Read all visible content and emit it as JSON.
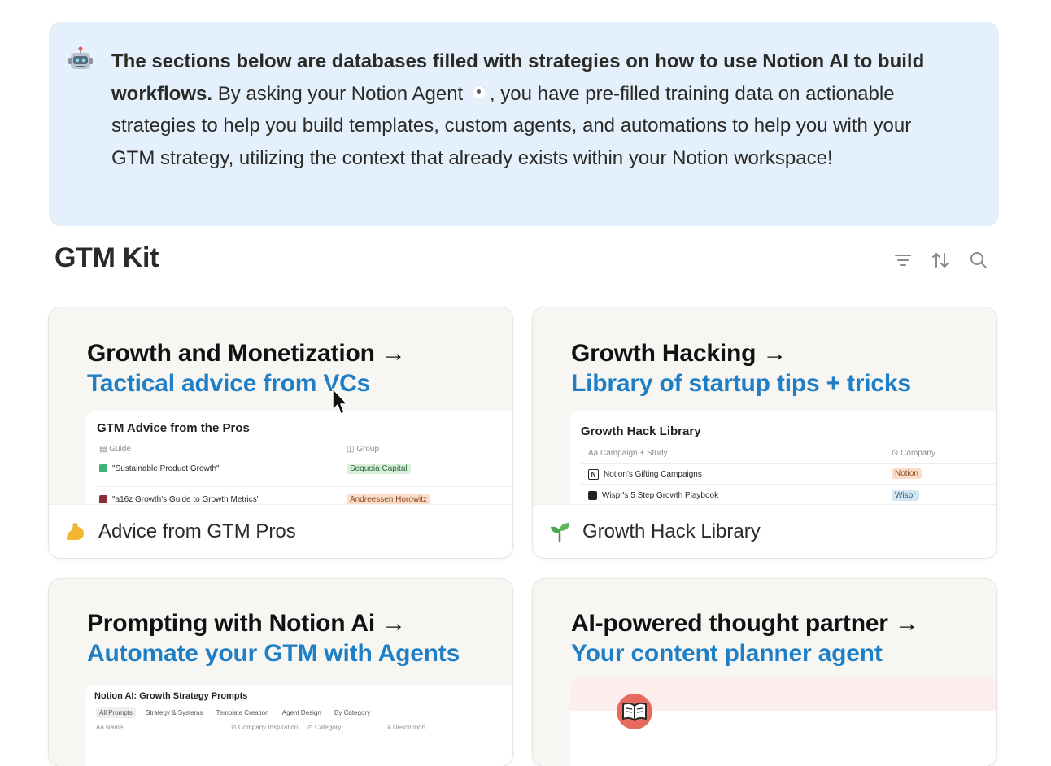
{
  "callout": {
    "icon": "robot-icon",
    "bold_text": "The sections below are databases filled with strategies on how to use Notion AI to build workflows.",
    "text_before_agent": " By asking your Notion Agent ",
    "text_after_agent": ", you have pre-filled training data on actionable strategies to help you build templates, custom agents, and automations to help you with your GTM strategy, utilizing the context that already exists within your Notion workspace!"
  },
  "section": {
    "title": "GTM Kit",
    "icons": [
      "filter-icon",
      "sort-icon",
      "search-icon"
    ]
  },
  "cards": [
    {
      "heading": "Growth and Monetization →",
      "subheading": "Tactical advice from VCs",
      "preview": {
        "title": "GTM Advice from the Pros",
        "col1": "Guide",
        "col2": "Group",
        "rows": [
          {
            "name": "\"Sustainable Product Growth\"",
            "tag": "Sequoia Capital"
          },
          {
            "name": "\"a16z Growth's Guide to Growth Metrics\"",
            "tag": "Andreessen Horowitz"
          }
        ]
      },
      "footer": "Advice from GTM Pros",
      "footer_icon": "flexed-biceps-icon"
    },
    {
      "heading": "Growth Hacking →",
      "subheading": "Library of startup tips + tricks",
      "preview": {
        "title": "Growth Hack Library",
        "col1": "Campaign + Study",
        "col2": "Company",
        "rows": [
          {
            "name": "Notion's Gifting Campaigns",
            "tag": "Notion"
          },
          {
            "name": "Wispr's 5 Step Growth Playbook",
            "tag": "Wispr"
          }
        ]
      },
      "footer": "Growth Hack Library",
      "footer_icon": "seedling-icon"
    },
    {
      "heading": "Prompting with Notion Ai →",
      "subheading": "Automate your GTM with Agents",
      "preview": {
        "title": "Notion AI: Growth Strategy Prompts",
        "tabs": [
          "All Prompts",
          "Strategy & Systems",
          "Template Creation",
          "Agent Design",
          "By Category"
        ],
        "col1": "Name",
        "col2": "Company Inspiration",
        "col3": "Category",
        "col4": "Description"
      }
    },
    {
      "heading": "AI-powered thought partner →",
      "subheading": "Your content planner agent",
      "preview_icon": "open-book-icon"
    }
  ],
  "colors": {
    "callout_bg": "#e4f1fc",
    "accent_blue": "#1f7fc6",
    "card_bg": "#f7f6f3"
  }
}
